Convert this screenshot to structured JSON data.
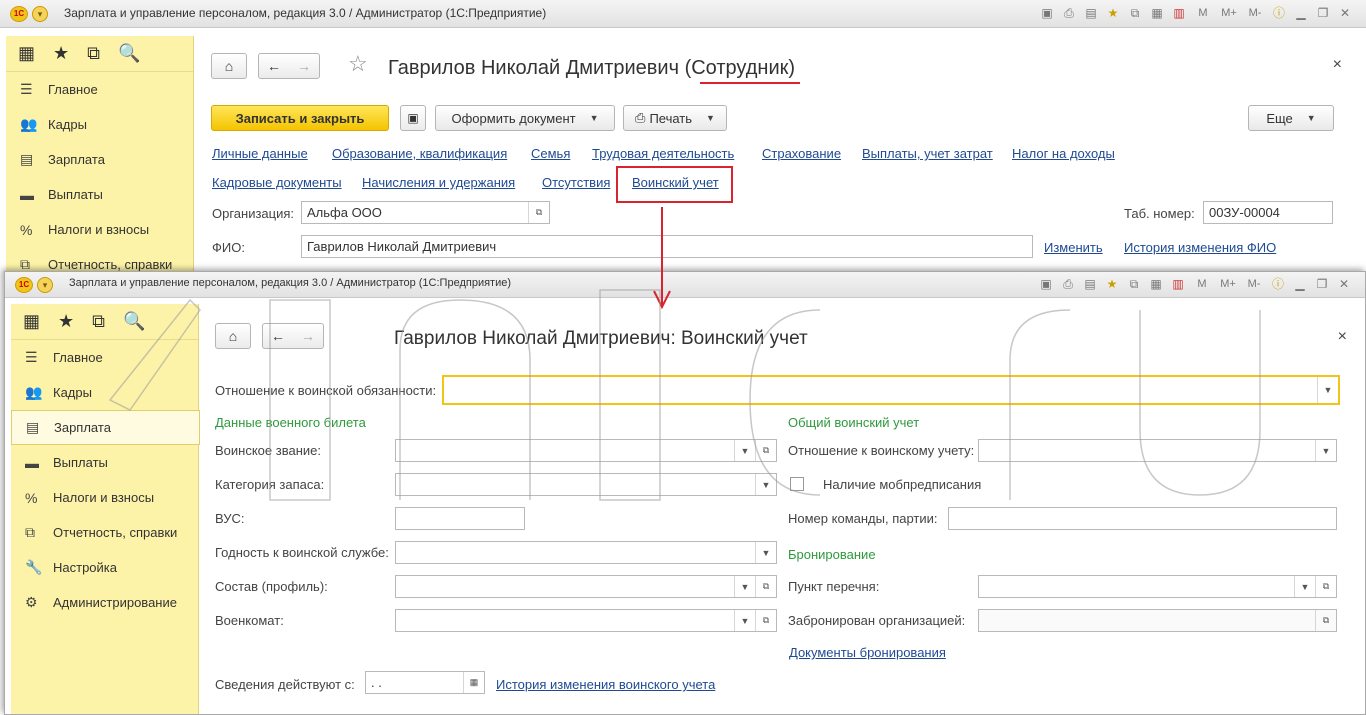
{
  "app_title": "Зарплата и управление персоналом, редакция 3.0 / Администратор  (1С:Предприятие)",
  "app_logo_text": "1С",
  "titlebar_icons": [
    "save-icon",
    "print-icon",
    "preview-icon",
    "favorites-icon",
    "history-icon",
    "calculator-icon",
    "calendar-icon",
    "memory-icon",
    "memory-plus-icon",
    "memory-minus-icon",
    "info-icon",
    "minimize-icon",
    "restore-icon",
    "close-icon"
  ],
  "titlebar_m_labels": [
    "M",
    "M+",
    "M-"
  ],
  "sidebar": {
    "top_icons": [
      "apps-grid-icon",
      "star-icon",
      "history-icon",
      "search-icon"
    ],
    "top_glyphs": [
      "▦",
      "★",
      "⧉",
      "🔍"
    ],
    "items": [
      {
        "label": "Главное",
        "icon": "menu-icon",
        "glyph": "☰"
      },
      {
        "label": "Кадры",
        "icon": "people-icon",
        "glyph": "👥"
      },
      {
        "label": "Зарплата",
        "icon": "payroll-icon",
        "glyph": "▤"
      },
      {
        "label": "Выплаты",
        "icon": "wallet-icon",
        "glyph": "▬"
      },
      {
        "label": "Налоги и взносы",
        "icon": "percent-icon",
        "glyph": "%"
      },
      {
        "label": "Отчетность, справки",
        "icon": "reports-icon",
        "glyph": "⧉"
      },
      {
        "label": "Настройка",
        "icon": "wrench-icon",
        "glyph": "🔧"
      },
      {
        "label": "Администрирование",
        "icon": "gear-icon",
        "glyph": "⚙"
      }
    ]
  },
  "back_form": {
    "title_prefix": "Гаврилов Николай Дмитриевич (",
    "title_highlight": "Сотрудник",
    "title_suffix": ")",
    "close": "×",
    "toolbar": {
      "save_close": "Записать и закрыть",
      "make_document": "Оформить документ",
      "print": "Печать",
      "more": "Еще"
    },
    "tabs_row1": [
      "Личные данные",
      "Образование, квалификация",
      "Семья",
      "Трудовая деятельность",
      "Страхование",
      "Выплаты, учет затрат",
      "Налог на доходы"
    ],
    "tabs_row2": [
      "Кадровые документы",
      "Начисления и удержания",
      "Отсутствия",
      "Воинский учет"
    ],
    "org_label": "Организация:",
    "org_value": "Альфа ООО",
    "tab_num_label": "Таб. номер:",
    "tab_num_value": "00ЗУ-00004",
    "fio_label": "ФИО:",
    "fio_value": "Гаврилов Николай Дмитриевич",
    "change_link": "Изменить",
    "fio_history_link": "История изменения ФИО"
  },
  "front_form": {
    "title": "Гаврилов Николай Дмитриевич: Воинский учет",
    "close": "×",
    "relation_label": "Отношение к воинской обязанности:",
    "relation_value": "",
    "left_section": "Данные военного билета",
    "left_fields": [
      {
        "label": "Воинское звание:",
        "value": ""
      },
      {
        "label": "Категория запаса:",
        "value": ""
      },
      {
        "label": "ВУС:",
        "value": ""
      },
      {
        "label": "Годность к воинской службе:",
        "value": ""
      },
      {
        "label": "Состав (профиль):",
        "value": ""
      },
      {
        "label": "Военкомат:",
        "value": ""
      }
    ],
    "right_section": "Общий воинский учет",
    "right_relation_label": "Отношение к воинскому учету:",
    "mob_label": "Наличие мобпредписания",
    "team_label": "Номер команды, партии:",
    "booking_section": "Бронирование",
    "list_item_label": "Пункт перечня:",
    "booked_by_label": "Забронирован организацией:",
    "booking_docs_link": "Документы бронирования",
    "valid_from_label": "Сведения действуют с:",
    "valid_from_value": " .  .",
    "history_link": "История изменения воинского учета"
  },
  "colors": {
    "accent_yellow": "#f0c419",
    "sidebar_bg": "#fdf3a8",
    "link": "#1f4a92",
    "section_green": "#2e9a3c",
    "annotation_red": "#d9232e"
  }
}
